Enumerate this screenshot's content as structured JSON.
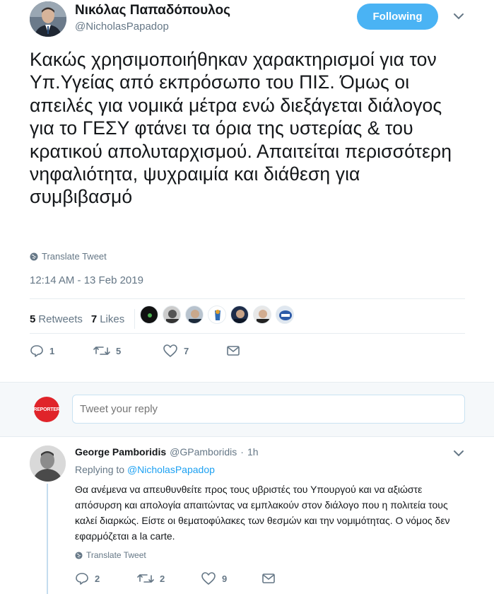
{
  "tweet": {
    "author_name": "Νικόλας Παπαδόπουλος",
    "author_handle": "@NicholasPapadop",
    "follow_label": "Following",
    "text": "Κακώς χρησιμοποιήθηκαν χαρακτηρισμοί για τον Υπ.Υγείας από εκπρόσωπο του ΠΙΣ. Όμως οι απειλές για νομικά μέτρα ενώ διεξάγεται διάλογος για το ΓΕΣΥ φτάνει τα όρια της υστερίας & του κρατικού απολυταρχισμού. Απαιτείται περισσότερη νηφαλιότητα, ψυχραιμία και διάθεση για συμβιβασμό",
    "translate_label": "Translate Tweet",
    "timestamp": "12:14 AM - 13 Feb 2019",
    "retweets_count": "5",
    "retweets_label": "Retweets",
    "likes_count": "7",
    "likes_label": "Likes",
    "actions": {
      "replies": "1",
      "retweets": "5",
      "likes": "7"
    },
    "icons": [
      "avatar",
      "chevron-down-icon",
      "globe-icon",
      "reply-icon",
      "retweet-icon",
      "heart-icon",
      "mail-icon"
    ]
  },
  "reply_box": {
    "avatar_text": "REPORTER",
    "placeholder": "Tweet your reply"
  },
  "reply": {
    "author_name": "George Pamboridis",
    "author_handle": "@GPamboridis",
    "separator": "·",
    "time": "1h",
    "replying_prefix": "Replying to",
    "replying_to": "@NicholasPapadop",
    "text": "Θα ανέμενα να απευθυνθείτε προς τους υβριστές του Υπουργού και να αξιώστε απόσυρση και απολογία απαιτώντας να εμπλακούν στον διάλογο που η πολιτεία τους καλεί διαρκώς. Είστε οι θεματοφύλακες των θεσμών και την νομιμότητας. Ο νόμος δεν εφαρμόζεται a la carte.",
    "translate_label": "Translate Tweet",
    "actions": {
      "replies": "2",
      "retweets": "2",
      "likes": "9"
    }
  },
  "colors": {
    "accent": "#1da1f2",
    "follow_bg": "#4ab3f4",
    "muted": "#657786",
    "reply_area_bg": "#f5f8fa",
    "reporter_red": "#e0242a"
  }
}
